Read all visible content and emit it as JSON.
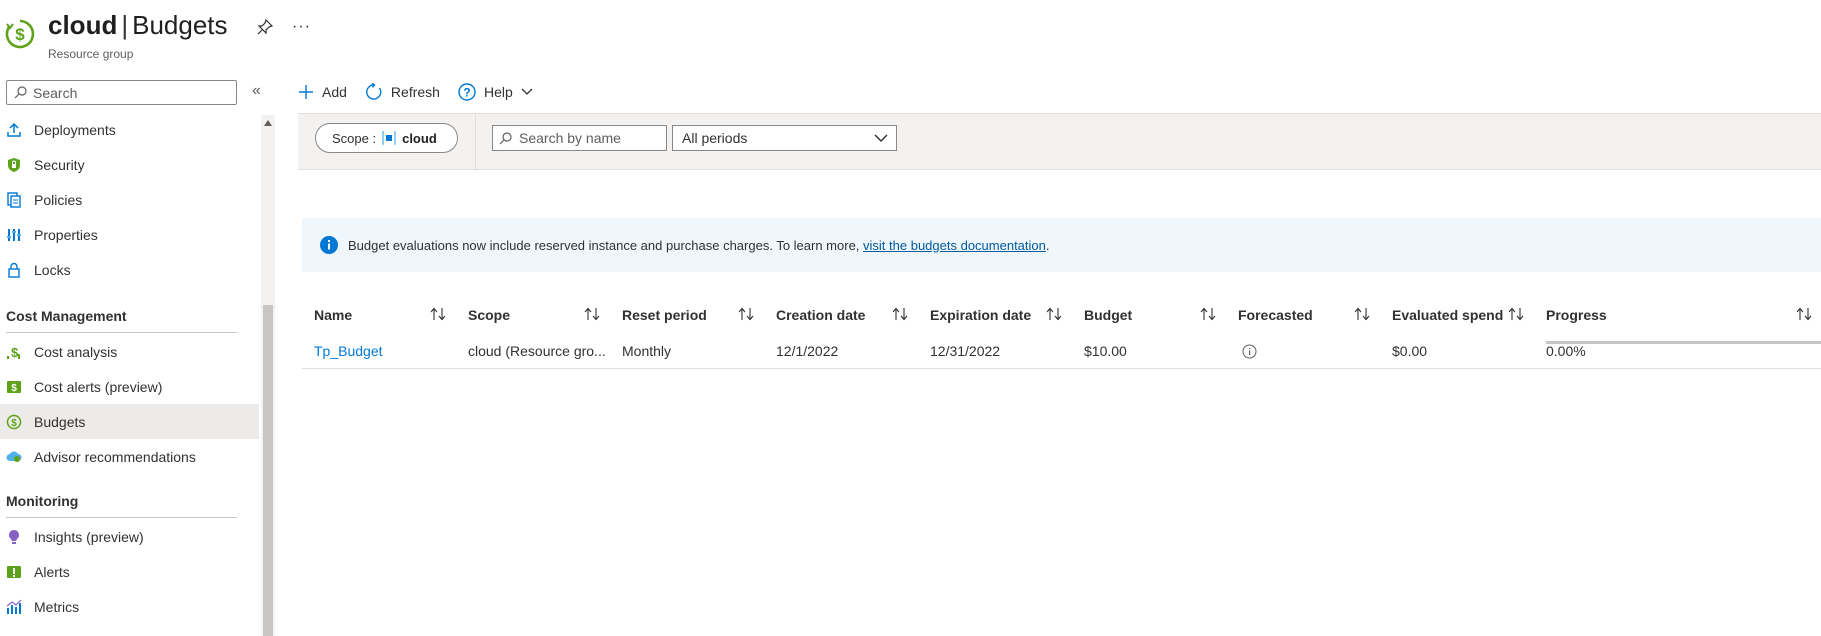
{
  "header": {
    "resource_name": "cloud",
    "separator": "|",
    "page_name": "Budgets",
    "subtitle": "Resource group",
    "more_label": "···"
  },
  "sidebar": {
    "search_placeholder": "Search",
    "collapse_label": "«",
    "items_top": [
      {
        "label": "Deployments",
        "icon": "deployments-icon"
      },
      {
        "label": "Security",
        "icon": "shield-icon"
      },
      {
        "label": "Policies",
        "icon": "policies-icon"
      },
      {
        "label": "Properties",
        "icon": "properties-icon"
      },
      {
        "label": "Locks",
        "icon": "lock-icon"
      }
    ],
    "section_cost": "Cost Management",
    "items_cost": [
      {
        "label": "Cost analysis",
        "icon": "cost-analysis-icon"
      },
      {
        "label": "Cost alerts (preview)",
        "icon": "cost-alerts-icon"
      },
      {
        "label": "Budgets",
        "icon": "budgets-icon",
        "active": true
      },
      {
        "label": "Advisor recommendations",
        "icon": "advisor-icon"
      }
    ],
    "section_monitoring": "Monitoring",
    "items_monitoring": [
      {
        "label": "Insights (preview)",
        "icon": "insights-icon"
      },
      {
        "label": "Alerts",
        "icon": "alerts-icon"
      },
      {
        "label": "Metrics",
        "icon": "metrics-icon"
      }
    ]
  },
  "toolbar": {
    "add_label": "Add",
    "refresh_label": "Refresh",
    "help_label": "Help"
  },
  "filters": {
    "scope_key": "Scope :",
    "scope_value": "cloud",
    "name_search_placeholder": "Search by name",
    "period_value": "All periods"
  },
  "banner": {
    "text": "Budget evaluations now include reserved instance and purchase charges. To learn more, ",
    "link_text": "visit the budgets documentation",
    "suffix": "."
  },
  "table": {
    "columns": [
      "Name",
      "Scope",
      "Reset period",
      "Creation date",
      "Expiration date",
      "Budget",
      "Forecasted",
      "Evaluated spend",
      "Progress"
    ],
    "rows": [
      {
        "name": "Tp_Budget",
        "scope": "cloud (Resource gro...",
        "reset_period": "Monthly",
        "creation_date": "12/1/2022",
        "expiration_date": "12/31/2022",
        "budget": "$10.00",
        "forecasted_icon": "info-circle-icon",
        "evaluated_spend": "$0.00",
        "progress": "0.00%"
      }
    ]
  },
  "colors": {
    "accent": "#0078d4",
    "budget_green": "#5ea21b",
    "banner_bg": "#eff6fc",
    "filter_bg": "#f3f2f1"
  }
}
